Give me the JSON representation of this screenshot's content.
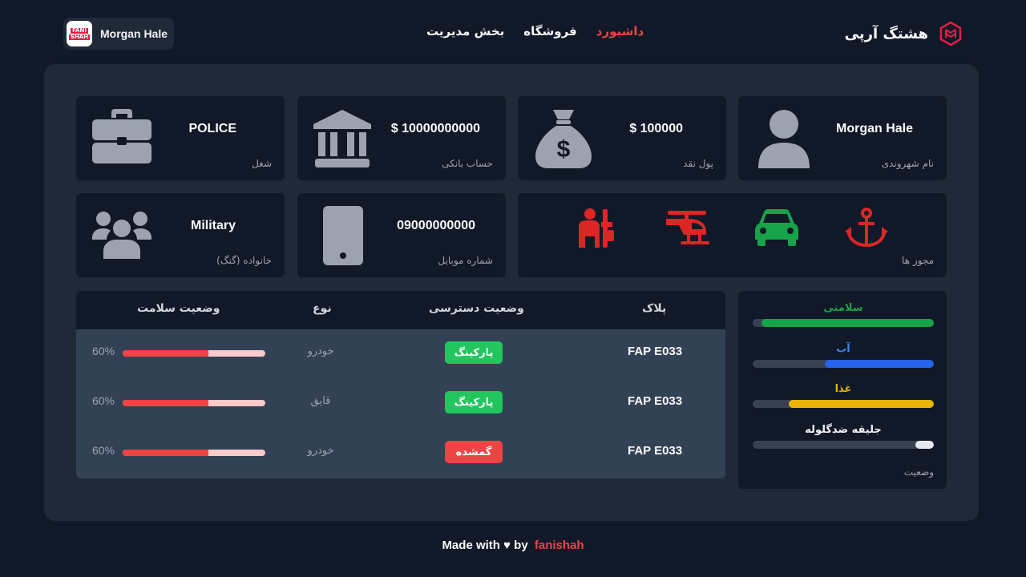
{
  "header": {
    "user": {
      "name": "Morgan Hale",
      "logo_line1": "FANI",
      "logo_line2": "SHAH"
    },
    "nav": [
      {
        "label": "داشبورد",
        "active": true
      },
      {
        "label": "فروشگاه",
        "active": false
      },
      {
        "label": "بخش مدیریت",
        "active": false
      }
    ],
    "brand": {
      "name": "هشتگ آرپی"
    }
  },
  "info_cards": {
    "citizen_name": {
      "value": "Morgan Hale",
      "label": "نام شهروندی",
      "icon": "user-icon"
    },
    "cash": {
      "value": "$ 100000",
      "label": "پول نقد",
      "icon": "money-bag-icon"
    },
    "bank": {
      "value": "$ 10000000000",
      "label": "حساب بانکی",
      "icon": "bank-icon"
    },
    "job": {
      "value": "POLICE",
      "label": "شغل",
      "icon": "briefcase-icon"
    },
    "licenses": {
      "label": "مجوز ها",
      "items": [
        {
          "icon": "anchor-icon",
          "color": "#dc2626"
        },
        {
          "icon": "car-icon",
          "color": "#16a34a"
        },
        {
          "icon": "helicopter-icon",
          "color": "#dc2626"
        },
        {
          "icon": "gun-license-icon",
          "color": "#dc2626"
        }
      ]
    },
    "phone": {
      "value": "09000000000",
      "label": "شماره موبایل",
      "icon": "phone-icon"
    },
    "family": {
      "value": "Military",
      "label": "خانواده (گنگ)",
      "icon": "users-icon"
    }
  },
  "vehicles": {
    "headers": {
      "plate": "پلاک",
      "access": "وضعیت دسترسی",
      "type": "نوع",
      "health": "وضعیت سلامت"
    },
    "rows": [
      {
        "plate": "FAP E033",
        "status": "پارکینگ",
        "status_color": "#22c55e",
        "type": "خودرو",
        "health": 0.6,
        "health_text": "60%"
      },
      {
        "plate": "FAP E033",
        "status": "پارکینگ",
        "status_color": "#22c55e",
        "type": "قایق",
        "health": 0.6,
        "health_text": "60%"
      },
      {
        "plate": "FAP E033",
        "status": "گمشده",
        "status_color": "#ef4444",
        "type": "خودرو",
        "health": 0.6,
        "health_text": "60%"
      }
    ]
  },
  "status": {
    "label": "وضعیت",
    "stats": [
      {
        "label": "سلامتی",
        "value": 0.95,
        "color": "#16a34a",
        "label_color": "#16a34a"
      },
      {
        "label": "آب",
        "value": 0.6,
        "color": "#2563eb",
        "label_color": "#3b82f6"
      },
      {
        "label": "غذا",
        "value": 0.8,
        "color": "#eab308",
        "label_color": "#eab308"
      },
      {
        "label": "جلیقه ضدگلوله",
        "value": 0.1,
        "color": "#e5e7eb",
        "label_color": "#f3f4f6"
      }
    ]
  },
  "footer": {
    "text": "Made with ♥ by",
    "author": "fanishah"
  }
}
